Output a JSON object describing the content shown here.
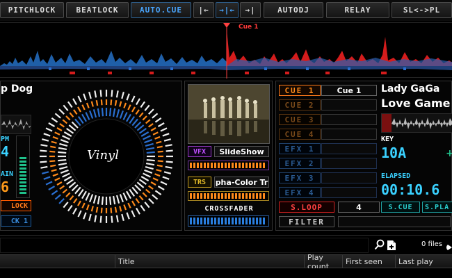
{
  "toolbar": {
    "pitchlock": "PITCHLOCK",
    "beatlock": "BEATLOCK",
    "auto_cue": "AUTO.CUE",
    "align_left": "|←",
    "align_center": "→|←",
    "align_right": "→|",
    "autodj": "AUTODJ",
    "relay": "RELAY",
    "sl_pl": "SL<->PL"
  },
  "waveform": {
    "cue_label": "Cue 1"
  },
  "left_deck": {
    "artist": "p Dog",
    "bpm_label": "PM",
    "bpm_value": "4",
    "gain_label": "AIN",
    "gain_value": "6",
    "pitchlock_btn": "LOCK",
    "cue_btn": "CK 1",
    "vinyl_label": "Vinyl"
  },
  "center": {
    "vfx_tag": "VFX",
    "vfx_name": "SlideShow",
    "trs_tag": "TRS",
    "trs_name": "pha-Color Tr",
    "crossfader_label": "CROSSFADER"
  },
  "right_deck": {
    "cues": [
      {
        "label": "CUE 1",
        "value": "Cue 1"
      },
      {
        "label": "CUE 2",
        "value": ""
      },
      {
        "label": "CUE 3",
        "value": ""
      },
      {
        "label": "CUE 4",
        "value": ""
      }
    ],
    "efx": [
      {
        "label": "EFX 1"
      },
      {
        "label": "EFX 2"
      },
      {
        "label": "EFX 3"
      },
      {
        "label": "EFX 4"
      }
    ],
    "sloop_label": "S.LOOP",
    "sloop_value": "4",
    "filter_label": "FILTER",
    "artist": "Lady GaGa",
    "title": "Love Game",
    "key_label": "KEY",
    "key_value": "10A",
    "elapsed_label": "ELAPSED",
    "elapsed_value": "00:10.6",
    "scue_label": "S.CUE",
    "splay_label": "S.PLA"
  },
  "browser": {
    "search_value": "",
    "files_count": "0 files",
    "columns": [
      "Title",
      "Play count",
      "First seen",
      "Last play"
    ]
  },
  "colors": {
    "accent_blue": "#3a8fe0",
    "accent_orange": "#ff8a1a",
    "accent_cyan": "#3ad1ff",
    "cue_red": "#ff3a3a"
  }
}
